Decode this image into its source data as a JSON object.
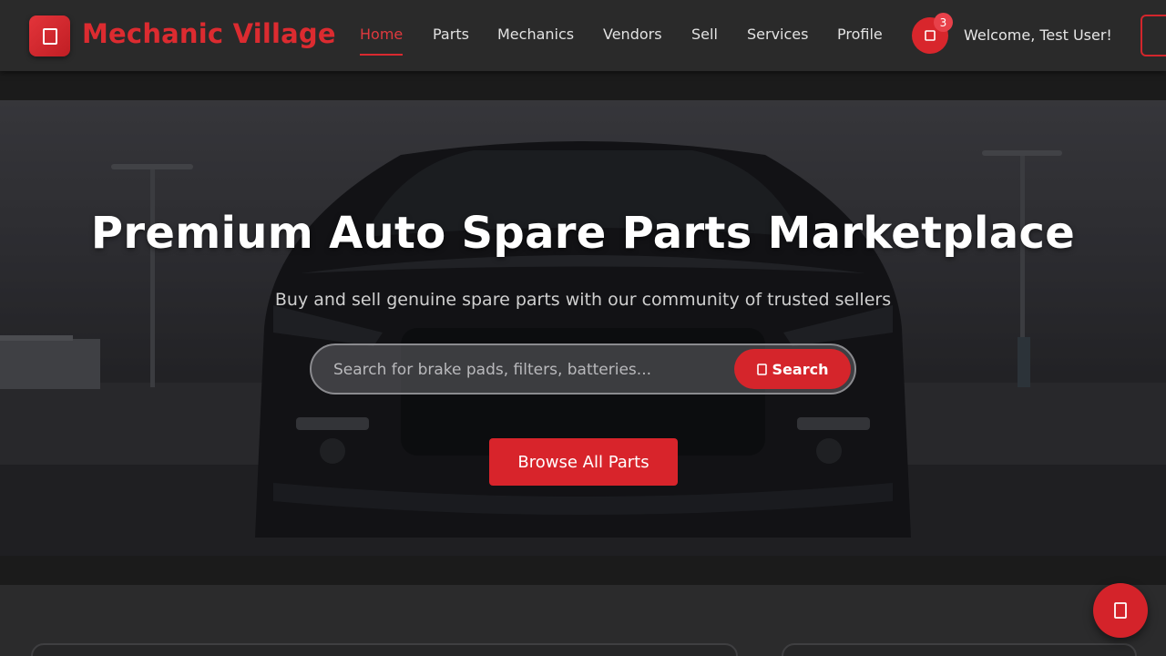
{
  "brand": {
    "name": "Mechanic Village",
    "icon": "wrench-icon",
    "accent_color": "#d8262c"
  },
  "nav": {
    "items": [
      {
        "label": "Home",
        "active": true
      },
      {
        "label": "Parts",
        "active": false
      },
      {
        "label": "Mechanics",
        "active": false
      },
      {
        "label": "Vendors",
        "active": false
      },
      {
        "label": "Sell",
        "active": false
      },
      {
        "label": "Services",
        "active": false
      },
      {
        "label": "Profile",
        "active": false
      }
    ]
  },
  "cart": {
    "icon": "cart-icon",
    "count": "3"
  },
  "user": {
    "welcome": "Welcome, Test User!"
  },
  "hero": {
    "title": "Premium Auto Spare Parts Marketplace",
    "subtitle": "Buy and sell genuine spare parts with our community of trusted sellers",
    "search_placeholder": "Search for brake pads, filters, batteries...",
    "search_button": "Search",
    "search_icon": "search-icon",
    "browse_button": "Browse All Parts"
  },
  "fab": {
    "icon": "chat-icon"
  }
}
